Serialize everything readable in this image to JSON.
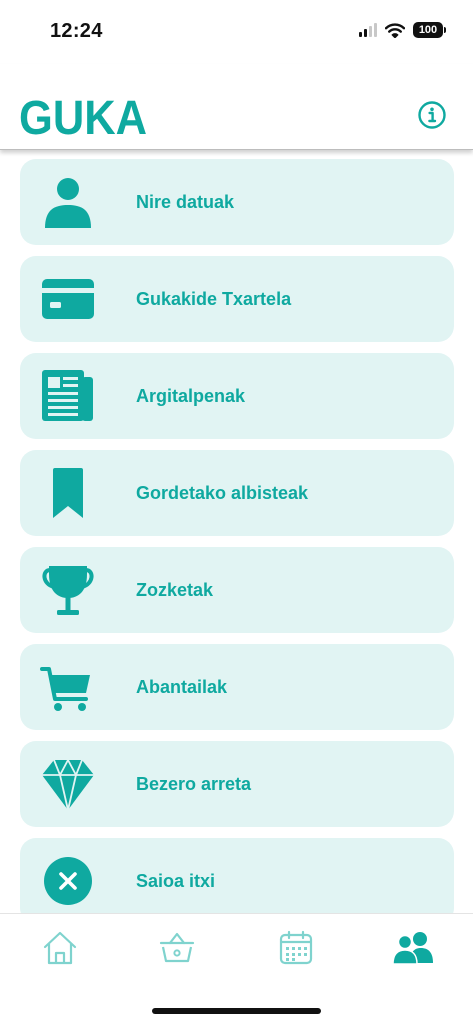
{
  "status_bar": {
    "time": "12:24",
    "battery": "100"
  },
  "header": {
    "logo_text": "GUKA"
  },
  "menu": {
    "items": [
      {
        "label": "Nire datuak",
        "icon": "user-icon"
      },
      {
        "label": "Gukakide Txartela",
        "icon": "card-icon"
      },
      {
        "label": "Argitalpenak",
        "icon": "newspaper-icon"
      },
      {
        "label": "Gordetako albisteak",
        "icon": "bookmark-icon"
      },
      {
        "label": "Zozketak",
        "icon": "trophy-icon"
      },
      {
        "label": "Abantailak",
        "icon": "cart-icon"
      },
      {
        "label": "Bezero arreta",
        "icon": "diamond-icon"
      },
      {
        "label": "Saioa itxi",
        "icon": "close-circle-icon"
      }
    ]
  },
  "tab_bar": {
    "tabs": [
      {
        "icon": "home-icon",
        "active": false
      },
      {
        "icon": "basket-icon",
        "active": false
      },
      {
        "icon": "calendar-icon",
        "active": false
      },
      {
        "icon": "users-icon",
        "active": true
      }
    ]
  },
  "colors": {
    "accent": "#0fa9a0",
    "tile_background": "#e1f4f3",
    "inactive_tab": "#7fd3ce"
  }
}
